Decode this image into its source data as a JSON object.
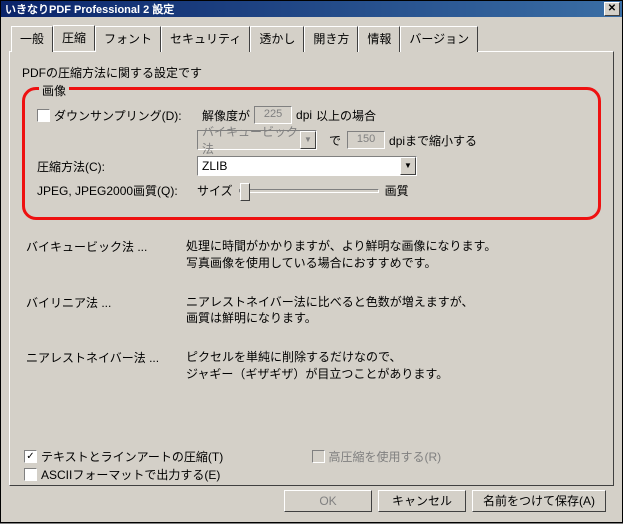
{
  "title": "いきなりPDF Professional 2 設定",
  "tabs": [
    "一般",
    "圧縮",
    "フォント",
    "セキュリティ",
    "透かし",
    "開き方",
    "情報",
    "バージョン"
  ],
  "active_tab_index": 1,
  "panel": {
    "desc": "PDFの圧縮方法に関する設定です",
    "image_group": {
      "legend": "画像",
      "downsample": {
        "checked": false,
        "label": "ダウンサンプリング(D):",
        "res_prefix": "解像度が",
        "res_value": "225",
        "res_unit": "dpi",
        "res_suffix": "以上の場合",
        "method_value": "バイキュービック法",
        "mid": "で",
        "target_value": "150",
        "target_unit": "dpiまで縮小する"
      },
      "compression": {
        "label": "圧縮方法(C):",
        "value": "ZLIB"
      },
      "jpeg_quality": {
        "label": "JPEG, JPEG2000画質(Q):",
        "left": "サイズ",
        "right": "画質",
        "position": 0
      }
    },
    "methods": [
      {
        "name": "バイキュービック法 ...",
        "desc": "処理に時間がかかりますが、より鮮明な画像になります。\n写真画像を使用している場合におすすめです。"
      },
      {
        "name": "バイリニア法 ...",
        "desc": "ニアレストネイバー法に比べると色数が増えますが、\n画質は鮮明になります。"
      },
      {
        "name": "ニアレストネイバー法 ...",
        "desc": "ピクセルを単純に削除するだけなので、\nジャギー（ギザギザ）が目立つことがあります。"
      }
    ],
    "bottom": {
      "text_lineart": {
        "checked": true,
        "label": "テキストとラインアートの圧縮(T)"
      },
      "high_compress": {
        "enabled": false,
        "checked": false,
        "label": "高圧縮を使用する(R)"
      },
      "ascii": {
        "checked": false,
        "label": "ASCIIフォーマットで出力する(E)"
      }
    }
  },
  "buttons": {
    "ok": "OK",
    "cancel": "キャンセル",
    "saveas": "名前をつけて保存(A)"
  }
}
